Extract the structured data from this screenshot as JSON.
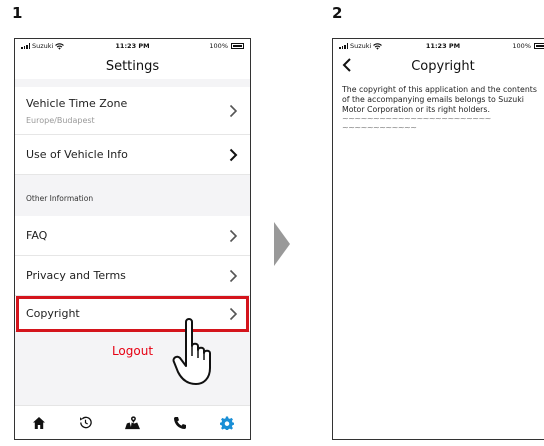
{
  "steps": {
    "first": "1",
    "second": "2"
  },
  "status_bar": {
    "carrier": "Suzuki",
    "time": "11:23 PM",
    "battery": "100%"
  },
  "settings": {
    "title": "Settings",
    "vehicle_time_zone": {
      "label": "Vehicle Time Zone",
      "value": "Europe/Budapest"
    },
    "use_of_vehicle_info": "Use of Vehicle Info",
    "section_other": "Other Information",
    "faq": "FAQ",
    "privacy_and_terms": "Privacy and Terms",
    "copyright": "Copyright",
    "logout": "Logout"
  },
  "tab_bar": [
    "home-icon",
    "history-icon",
    "map-icon",
    "phone-icon",
    "settings-gear-icon"
  ],
  "copyright_page": {
    "title": "Copyright",
    "body": "The copyright of this application and the contents of the accompanying emails belongs to Suzuki Motor Corporation or its right holders.",
    "tilde_line_1": "~~~~~~~~~~~~~~~~~~~~~~~~",
    "tilde_line_2": "~~~~~~~~~~~~"
  },
  "colors": {
    "highlight": "#d4141c",
    "logout": "#e60012",
    "accent": "#1a8fd6"
  }
}
